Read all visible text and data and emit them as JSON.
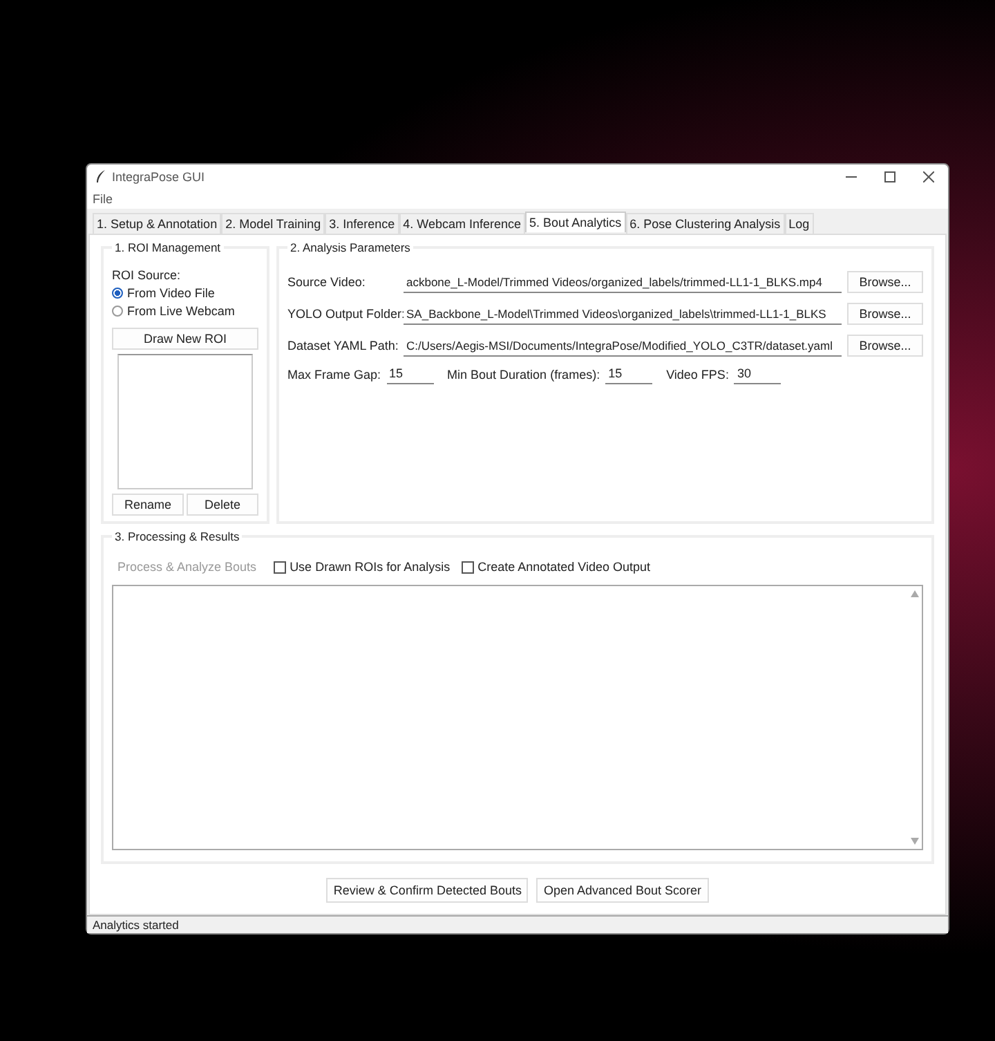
{
  "window": {
    "title": "IntegraPose GUI"
  },
  "menu": [
    "File"
  ],
  "tabs": [
    {
      "label": "1. Setup & Annotation",
      "selected": false
    },
    {
      "label": "2. Model Training",
      "selected": false
    },
    {
      "label": "3. Inference",
      "selected": false
    },
    {
      "label": "4. Webcam Inference",
      "selected": false
    },
    {
      "label": "5. Bout Analytics",
      "selected": true
    },
    {
      "label": "6. Pose Clustering Analysis",
      "selected": false
    },
    {
      "label": "Log",
      "selected": false
    }
  ],
  "roi_management": {
    "title": "1. ROI Management",
    "source_label": "ROI Source:",
    "sources": [
      {
        "label": "From Video File",
        "selected": true
      },
      {
        "label": "From Live Webcam",
        "selected": false
      }
    ],
    "draw_button": "Draw New ROI",
    "buttons": [
      "Rename",
      "Delete"
    ]
  },
  "analysis_parameters": {
    "title": "2. Analysis Parameters",
    "paths": [
      {
        "label": "Source Video:",
        "value": "ackbone_L-Model/Trimmed Videos/organized_labels/trimmed-LL1-1_BLKS.mp4",
        "button": "Browse..."
      },
      {
        "label": "YOLO Output Folder:",
        "value": "SA_Backbone_L-Model\\Trimmed Videos\\organized_labels\\trimmed-LL1-1_BLKS",
        "button": "Browse..."
      },
      {
        "label": "Dataset YAML Path:",
        "value": "C:/Users/Aegis-MSI/Documents/IntegraPose/Modified_YOLO_C3TR/dataset.yaml",
        "button": "Browse..."
      }
    ],
    "numbers": [
      {
        "label": "Max Frame Gap:",
        "value": "15"
      },
      {
        "label": "Min Bout Duration (frames):",
        "value": "15"
      },
      {
        "label": "Video FPS:",
        "value": "30"
      }
    ]
  },
  "processing": {
    "title": "3. Processing & Results",
    "process_button": {
      "label": "Process & Analyze Bouts",
      "disabled": true
    },
    "options": [
      {
        "label": "Use Drawn ROIs for Analysis",
        "checked": false
      },
      {
        "label": "Create Annotated Video Output",
        "checked": false
      }
    ]
  },
  "bottom_buttons": [
    "Review & Confirm Detected Bouts",
    "Open Advanced Bout Scorer"
  ],
  "status_bar": "Analytics started"
}
